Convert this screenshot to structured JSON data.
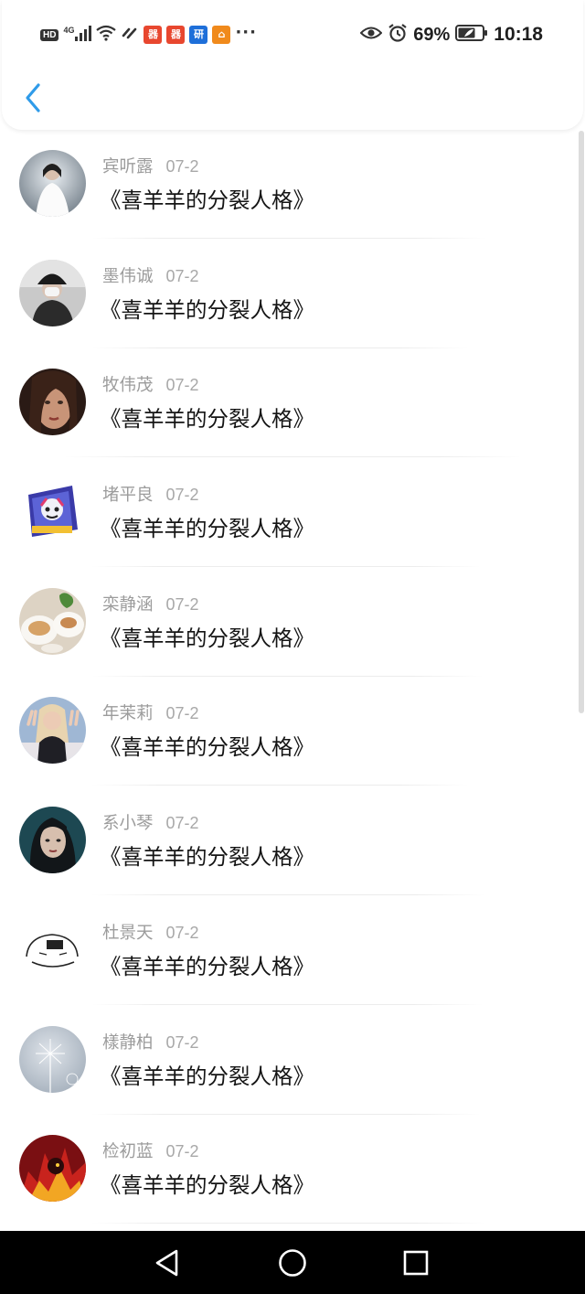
{
  "status_bar": {
    "hd": "HD",
    "network": "4G",
    "battery_percent": "69%",
    "time": "10:18",
    "more": "···",
    "app_icons": [
      {
        "name": "red-app-icon-1",
        "color": "#e8472f",
        "glyph": "器"
      },
      {
        "name": "red-app-icon-2",
        "color": "#e8472f",
        "glyph": "器"
      },
      {
        "name": "blue-app-icon",
        "color": "#1e6fd9",
        "glyph": "研"
      },
      {
        "name": "orange-app-icon",
        "color": "#f08a1c",
        "glyph": "⌂"
      }
    ]
  },
  "header": {
    "back_icon": "chevron-left-icon",
    "accent_color": "#2f9be9"
  },
  "list": {
    "items": [
      {
        "name": "宾听露",
        "date": "07-2",
        "title": "《喜羊羊的分裂人格》",
        "avatar": "person-in-white-fur-avatar"
      },
      {
        "name": "墨伟诚",
        "date": "07-2",
        "title": "《喜羊羊的分裂人格》",
        "avatar": "person-in-bucket-hat-mask-avatar"
      },
      {
        "name": "牧伟茂",
        "date": "07-2",
        "title": "《喜羊羊的分裂人格》",
        "avatar": "girl-portrait-avatar"
      },
      {
        "name": "堵平良",
        "date": "07-2",
        "title": "《喜羊羊的分裂人格》",
        "avatar": "cartoon-sticker-avatar"
      },
      {
        "name": "栾静涵",
        "date": "07-2",
        "title": "《喜羊羊的分裂人格》",
        "avatar": "food-plates-avatar"
      },
      {
        "name": "年茉莉",
        "date": "07-2",
        "title": "《喜羊羊的分裂人格》",
        "avatar": "blonde-girl-peace-sign-avatar"
      },
      {
        "name": "系小琴",
        "date": "07-2",
        "title": "《喜羊羊的分裂人格》",
        "avatar": "dark-hair-girl-teal-avatar"
      },
      {
        "name": "杜景天",
        "date": "07-2",
        "title": "《喜羊羊的分裂人格》",
        "avatar": "line-drawing-face-avatar"
      },
      {
        "name": "樣静柏",
        "date": "07-2",
        "title": "《喜羊羊的分裂人格》",
        "avatar": "dandelion-avatar"
      },
      {
        "name": "检初蓝",
        "date": "07-2",
        "title": "《喜羊羊的分裂人格》",
        "avatar": "red-flame-anime-avatar"
      }
    ]
  },
  "nav_bar": {
    "back": "triangle-back-icon",
    "home": "circle-home-icon",
    "recents": "square-recents-icon"
  }
}
